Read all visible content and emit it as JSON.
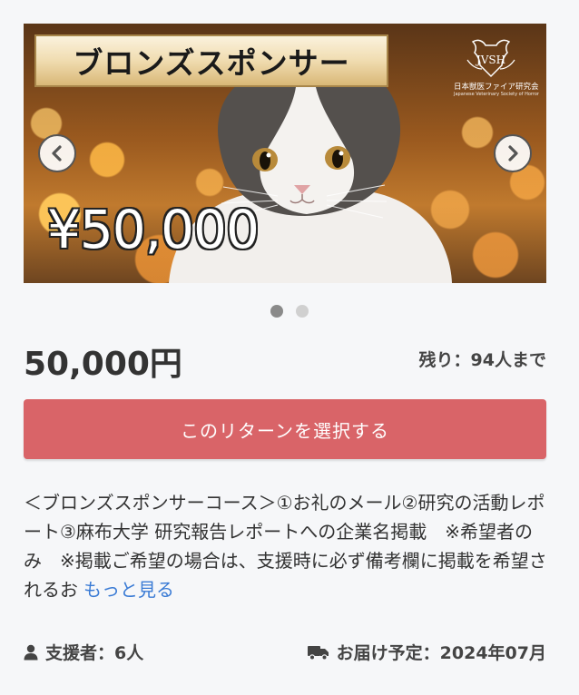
{
  "banner": {
    "title": "ブロンズスポンサー",
    "price": "¥50,000",
    "logo_mark": "JVSH",
    "logo_org": "日本獣医ファイア研究会",
    "logo_sub": "Japanese Veterinary Society of Horror"
  },
  "carousel": {
    "prev_icon": "chevron-left-icon",
    "next_icon": "chevron-right-icon",
    "dot_count": 2,
    "active_index": 0
  },
  "reward": {
    "price": "50,000円",
    "remaining": "残り：94人まで",
    "select_label": "このリターンを選択する",
    "description": "＜ブロンズスポンサーコース＞①お礼のメール②研究の活動レポート③麻布大学 研究報告レポートへの企業名掲載　※希望者のみ　※掲載ご希望の場合は、支援時に必ず備考欄に掲載を希望されるお",
    "more_label": "もっと見る",
    "supporters": "支援者：6人",
    "delivery": "お届け予定：2024年07月"
  },
  "colors": {
    "accent": "#d96468",
    "link": "#3a7bd5",
    "text": "#333333",
    "background": "#f6f7f9"
  },
  "icons": {
    "supporters": "user-icon",
    "delivery": "truck-icon"
  }
}
